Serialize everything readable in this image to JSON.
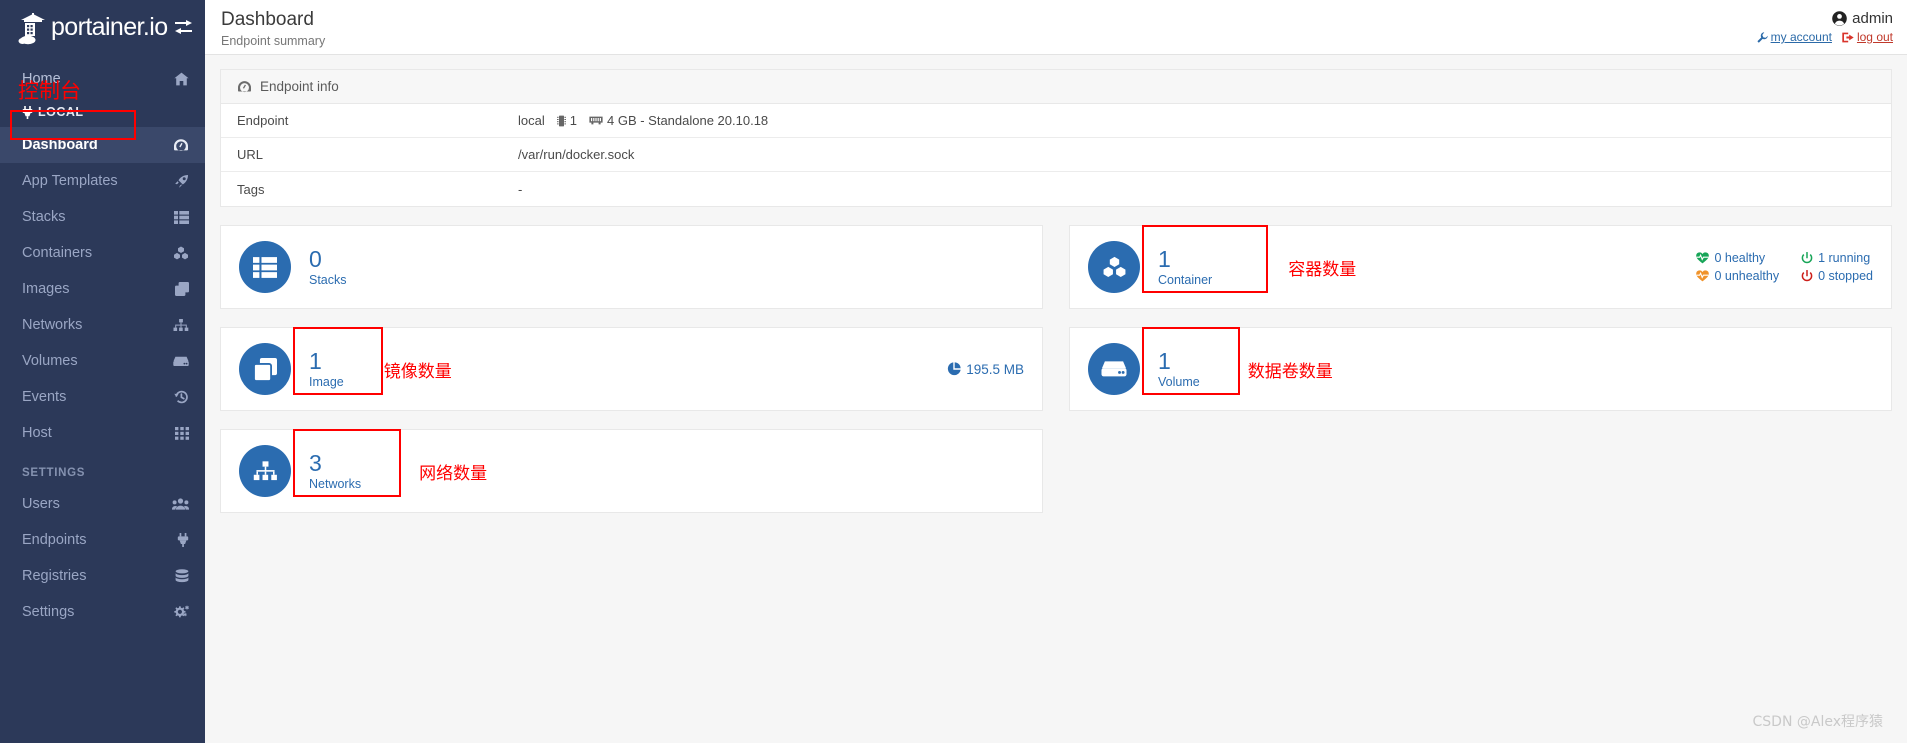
{
  "brand": {
    "name": "portainer.io",
    "toggle_icon": "collapse-sidebar-icon"
  },
  "sidebar": {
    "home": {
      "label": "Home",
      "icon": "home-icon"
    },
    "local": {
      "label": "LOCAL",
      "icon": "plug-icon"
    },
    "annotation_console": "控制台",
    "items": [
      {
        "label": "Dashboard",
        "icon": "dashboard-icon",
        "active": true
      },
      {
        "label": "App Templates",
        "icon": "rocket-icon",
        "active": false
      },
      {
        "label": "Stacks",
        "icon": "list-icon",
        "active": false
      },
      {
        "label": "Containers",
        "icon": "containers-icon",
        "active": false
      },
      {
        "label": "Images",
        "icon": "images-icon",
        "active": false
      },
      {
        "label": "Networks",
        "icon": "networks-icon",
        "active": false
      },
      {
        "label": "Volumes",
        "icon": "volume-icon",
        "active": false
      },
      {
        "label": "Events",
        "icon": "history-icon",
        "active": false
      },
      {
        "label": "Host",
        "icon": "grid-icon",
        "active": false
      }
    ],
    "settings_title": "SETTINGS",
    "settings_items": [
      {
        "label": "Users",
        "icon": "users-icon"
      },
      {
        "label": "Endpoints",
        "icon": "plug-icon"
      },
      {
        "label": "Registries",
        "icon": "database-icon"
      },
      {
        "label": "Settings",
        "icon": "gears-icon"
      }
    ]
  },
  "header": {
    "title": "Dashboard",
    "subtitle": "Endpoint summary",
    "user": "admin",
    "user_icon": "user-circle-icon",
    "my_account": "my account",
    "my_account_icon": "wrench-icon",
    "log_out": "log out",
    "log_out_icon": "sign-out-icon"
  },
  "endpoint_info": {
    "panel_title": "Endpoint info",
    "panel_icon": "dashboard-icon",
    "rows": [
      {
        "key": "Endpoint",
        "value": "local",
        "cpu": "1",
        "memory": "4 GB - Standalone 20.10.18"
      },
      {
        "key": "URL",
        "value": "/var/run/docker.sock"
      },
      {
        "key": "Tags",
        "value": "-"
      }
    ]
  },
  "cards": {
    "stacks": {
      "count": "0",
      "label": "Stacks",
      "icon": "list-icon"
    },
    "images": {
      "count": "1",
      "label": "Image",
      "icon": "images-icon",
      "size": "195.5 MB",
      "size_icon": "pie-chart-icon",
      "annotation": "镜像数量"
    },
    "networks": {
      "count": "3",
      "label": "Networks",
      "icon": "networks-icon",
      "annotation": "网络数量"
    },
    "containers": {
      "count": "1",
      "label": "Container",
      "icon": "containers-icon",
      "annotation": "容器数量"
    },
    "volumes": {
      "count": "1",
      "label": "Volume",
      "icon": "volume-icon",
      "annotation": "数据卷数量"
    }
  },
  "container_status": {
    "healthy": {
      "value": "0 healthy",
      "icon": "heartbeat-green-icon",
      "color": "#18a558"
    },
    "unhealthy": {
      "value": "0 unhealthy",
      "icon": "heartbeat-orange-icon",
      "color": "#f0932b"
    },
    "running": {
      "value": "1 running",
      "icon": "power-green-icon",
      "color": "#18a558"
    },
    "stopped": {
      "value": "0 stopped",
      "icon": "power-red-icon",
      "color": "#cc1f1a"
    }
  },
  "watermark": "CSDN @Alex程序猿"
}
